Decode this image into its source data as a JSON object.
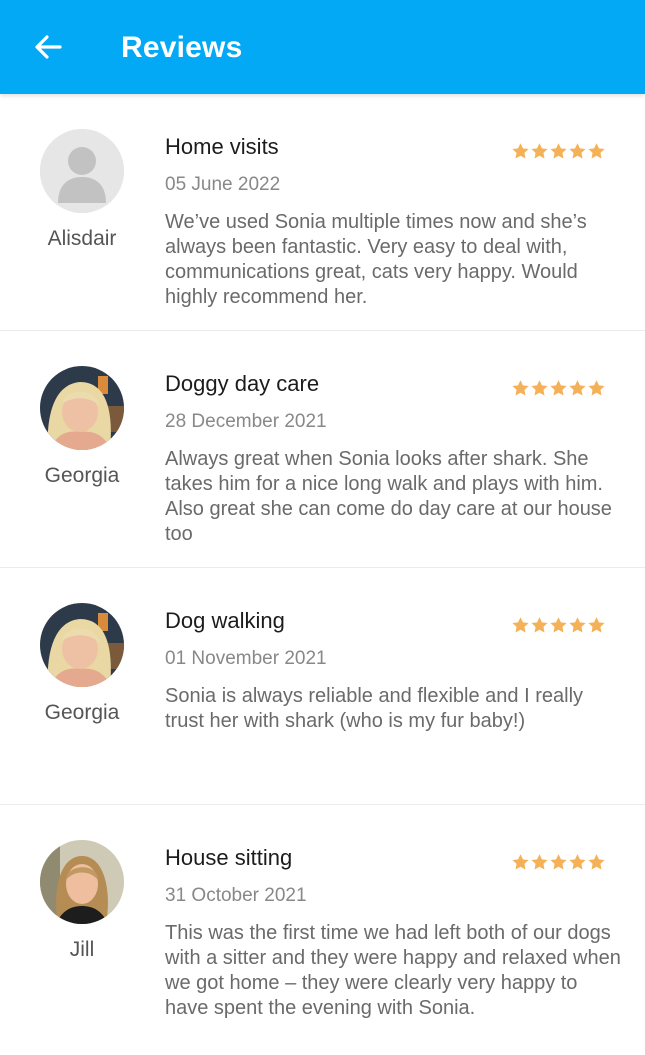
{
  "header": {
    "title": "Reviews",
    "back_icon": "arrow-left-icon"
  },
  "colors": {
    "appbar": "#03a9f4",
    "star": "#f5b158"
  },
  "reviews": [
    {
      "reviewer": "Alisdair",
      "avatar": "default-avatar",
      "service": "Home visits",
      "date": "05 June 2022",
      "rating": 5,
      "text": "We’ve used Sonia multiple times now and she’s always been fantastic.  Very easy to deal with, communications great, cats very happy. Would highly recommend her."
    },
    {
      "reviewer": "Georgia",
      "avatar": "photo",
      "service": "Doggy day care",
      "date": "28 December 2021",
      "rating": 5,
      "text": "Always great when Sonia looks after shark. She takes him for a nice long walk and plays with him. Also great she can come do day care at our house too"
    },
    {
      "reviewer": "Georgia",
      "avatar": "photo",
      "service": "Dog walking",
      "date": "01 November 2021",
      "rating": 5,
      "text": "Sonia is always reliable and flexible and I really trust her with shark (who is my fur baby!)"
    },
    {
      "reviewer": "Jill",
      "avatar": "photo",
      "service": "House sitting",
      "date": "31 October 2021",
      "rating": 5,
      "text": "This was the first time we had left both of our dogs with a sitter and they were happy and relaxed when we got home – they were clearly very happy to have spent the evening with Sonia."
    }
  ]
}
